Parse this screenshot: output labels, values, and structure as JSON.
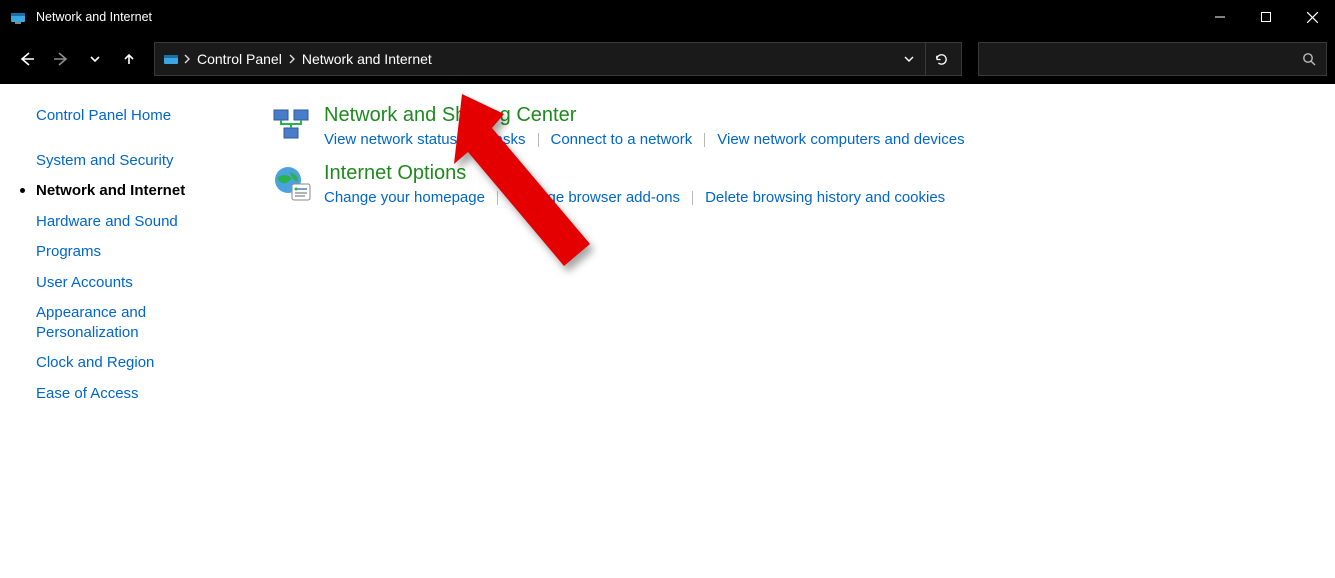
{
  "window": {
    "title": "Network and Internet"
  },
  "breadcrumb": {
    "items": [
      "Control Panel",
      "Network and Internet"
    ]
  },
  "sidebar": {
    "items": [
      {
        "label": "Control Panel Home",
        "active": false
      },
      {
        "label": "System and Security",
        "active": false
      },
      {
        "label": "Network and Internet",
        "active": true
      },
      {
        "label": "Hardware and Sound",
        "active": false
      },
      {
        "label": "Programs",
        "active": false
      },
      {
        "label": "User Accounts",
        "active": false
      },
      {
        "label": "Appearance and Personalization",
        "active": false
      },
      {
        "label": "Clock and Region",
        "active": false
      },
      {
        "label": "Ease of Access",
        "active": false
      }
    ]
  },
  "categories": [
    {
      "title": "Network and Sharing Center",
      "links": [
        "View network status and tasks",
        "Connect to a network",
        "View network computers and devices"
      ]
    },
    {
      "title": "Internet Options",
      "links": [
        "Change your homepage",
        "Manage browser add-ons",
        "Delete browsing history and cookies"
      ]
    }
  ],
  "search": {
    "placeholder": ""
  }
}
